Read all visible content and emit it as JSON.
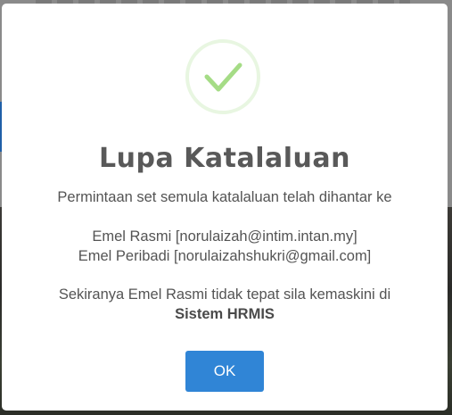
{
  "dialog": {
    "title": "Lupa Katalaluan",
    "message_intro": "Permintaan set semula katalaluan telah dihantar ke",
    "official_email_line": "Emel Rasmi [norulaizah@intim.intan.my]",
    "personal_email_line": "Emel Peribadi [norulaizahshukri@gmail.com]",
    "note_line": "Sekiranya Emel Rasmi tidak tepat sila kemaskini di",
    "system_name": "Sistem HRMIS",
    "ok_label": "OK"
  },
  "icon": {
    "name": "success-check-icon",
    "color": "#a5dc86"
  },
  "colors": {
    "button": "#3085d6",
    "title": "#595959",
    "text": "#545454"
  }
}
